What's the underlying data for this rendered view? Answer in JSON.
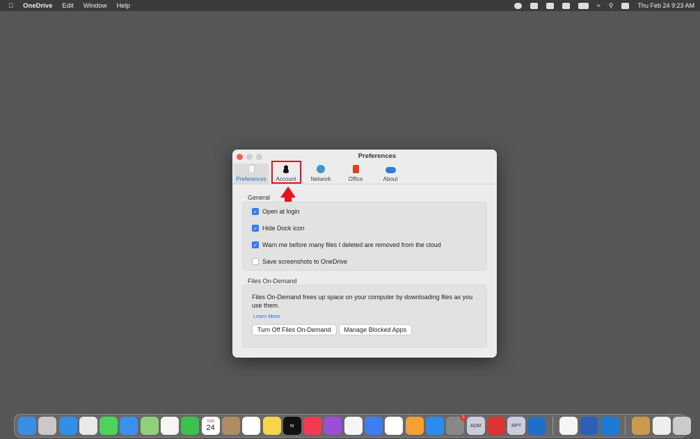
{
  "menubar": {
    "app": "OneDrive",
    "items": [
      "Edit",
      "Window",
      "Help"
    ],
    "clock": "Thu Feb 24  9:23 AM"
  },
  "window": {
    "title": "Preferences",
    "tabs": [
      {
        "label": "Preferences"
      },
      {
        "label": "Account"
      },
      {
        "label": "Network"
      },
      {
        "label": "Office"
      },
      {
        "label": "About"
      }
    ],
    "general": {
      "heading": "General",
      "options": [
        {
          "label": "Open at login",
          "checked": true
        },
        {
          "label": "Hide Dock icon",
          "checked": true
        },
        {
          "label": "Warn me before many files I deleted are removed from the cloud",
          "checked": true
        },
        {
          "label": "Save screenshots to OneDrive",
          "checked": false
        }
      ]
    },
    "fod": {
      "heading": "Files On-Demand",
      "description": "Files On-Demand frees up space on your computer by downloading files as you use them.",
      "learn_more": "Learn More",
      "btn_off": "Turn Off Files On-Demand",
      "btn_blocked": "Manage Blocked Apps"
    }
  },
  "dock": {
    "calendar_month": "FEB",
    "calendar_day": "24",
    "tv": "tv",
    "badge": "1",
    "labels": [
      "ADM",
      "RPT"
    ],
    "apps": [
      [
        "finder",
        "#3a8ee6"
      ],
      [
        "launchpad",
        "#c9c9c9"
      ],
      [
        "safari",
        "#2f8fe8"
      ],
      [
        "chrome",
        "#e9e9e9"
      ],
      [
        "messages",
        "#4cd35a"
      ],
      [
        "mail",
        "#3a90f0"
      ],
      [
        "maps",
        "#8fd07a"
      ],
      [
        "photos",
        "#f5f5f5"
      ],
      [
        "facetime",
        "#3ac14e"
      ],
      [
        "calendar",
        "#fff"
      ],
      [
        "contacts",
        "#b08c63"
      ],
      [
        "reminders",
        "#fff"
      ],
      [
        "notes",
        "#f7d54a"
      ],
      [
        "tv",
        "#111"
      ],
      [
        "music",
        "#f53a52"
      ],
      [
        "podcasts",
        "#9b4fd6"
      ],
      [
        "news",
        "#f5f5f5"
      ],
      [
        "keynote",
        "#3d7ef0"
      ],
      [
        "numbers",
        "#fff"
      ],
      [
        "pages",
        "#f5a030"
      ],
      [
        "app-store",
        "#2a8bf2"
      ],
      [
        "system-preferences",
        "#888"
      ],
      [
        "adm-app",
        "#ccd"
      ],
      [
        "app-red",
        "#d33"
      ],
      [
        "rpt-app",
        "#ccd"
      ],
      [
        "outlook",
        "#1f6fc8"
      ],
      [
        "slack",
        "#f5f5f5"
      ],
      [
        "word",
        "#2b5fb8"
      ],
      [
        "onedrive",
        "#1c7bd8"
      ],
      [
        "archive-utility",
        "#c89a4a"
      ],
      [
        "preview",
        "#eee"
      ],
      [
        "trash",
        "#ccc"
      ]
    ]
  }
}
